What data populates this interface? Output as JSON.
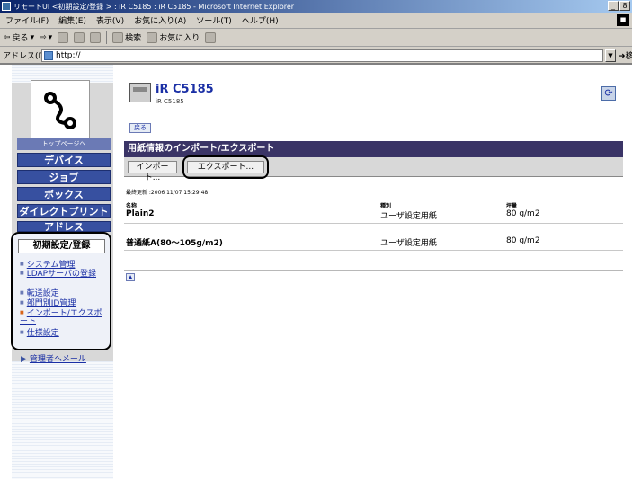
{
  "window": {
    "title": "リモートUI <初期設定/登録 > : iR C5185 : iR C5185 - Microsoft Internet Explorer",
    "min": "_",
    "max": "8"
  },
  "menubar": [
    "ファイル(F)",
    "編集(E)",
    "表示(V)",
    "お気に入り(A)",
    "ツール(T)",
    "ヘルプ(H)"
  ],
  "toolbar": {
    "back": "戻る",
    "search": "検索",
    "favorites": "お気に入り"
  },
  "address": {
    "label": "アドレス(D)",
    "url": "http://",
    "go": "移動"
  },
  "sidebar": {
    "top_page": "トップページへ",
    "nav": [
      "デバイス",
      "ジョブ",
      "ボックス",
      "ダイレクトプリント",
      "アドレス"
    ],
    "group_title": "初期設定/登録",
    "sub_items": [
      "システム管理",
      "LDAPサーバの登録",
      "転送設定",
      "部門別ID管理",
      "インポート/エクスポート",
      "仕様設定"
    ],
    "mail": "管理者へメール"
  },
  "device": {
    "name": "iR C5185",
    "model": "iR C5185"
  },
  "back_label": "戻る",
  "panel": {
    "title": "用紙情報のインポート/エクスポート",
    "import_btn": "インポート...",
    "export_btn": "エクスポート..."
  },
  "last_updated": "最終更新 :2006 11/07 15:29:48",
  "table": {
    "headers": [
      "名称",
      "種別",
      "坪量"
    ],
    "rows": [
      [
        "Plain2",
        "ユーザ設定用紙",
        "80 g/m2"
      ],
      [
        "普通紙A(80～105g/m2)",
        "ユーザ設定用紙",
        "80 g/m2"
      ]
    ]
  },
  "colors": {
    "nav_blue": "#3750a0",
    "panel_header": "#3a3466",
    "link": "#1a2fa5"
  }
}
